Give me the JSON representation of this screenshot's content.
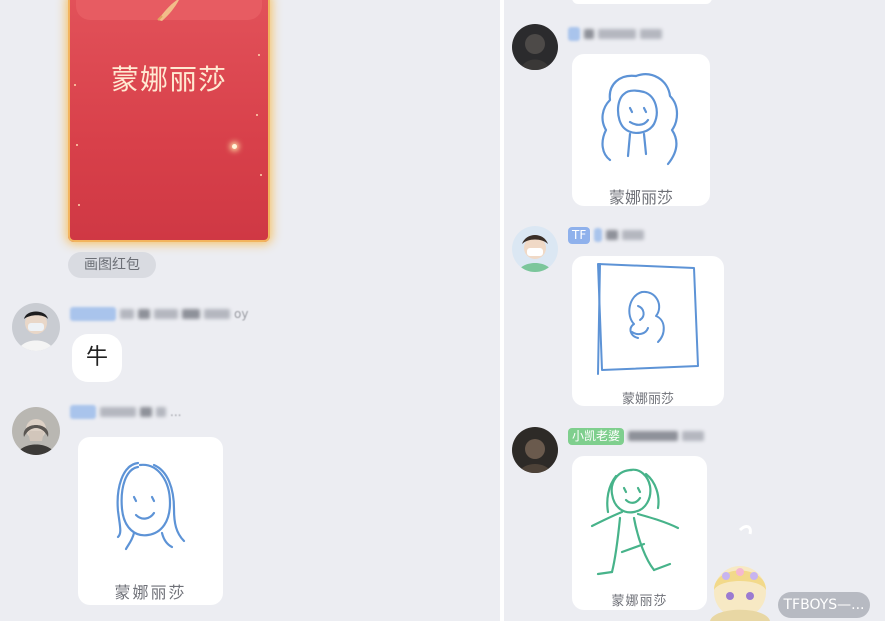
{
  "left_pane": {
    "red_envelope": {
      "title": "蒙娜丽莎"
    },
    "envelope_tag": "画图红包",
    "msg1": {
      "name_fragment": "oy",
      "text": "牛"
    },
    "msg2": {
      "name_fragment": "...",
      "caption": "蒙娜丽莎"
    }
  },
  "right_pane": {
    "msg1": {
      "caption": "蒙娜丽莎"
    },
    "msg2": {
      "badge": "TF",
      "caption": "蒙娜丽莎"
    },
    "msg3": {
      "badge": "小凯老婆",
      "caption": "蒙娜丽莎"
    }
  },
  "floating_label": "TFBOYS—...",
  "colors": {
    "background": "#ecedf2",
    "envelope_red": "#d8404a",
    "envelope_glow": "#f6bf5c",
    "drawing_blue": "#5d93d6",
    "drawing_green": "#47b38a",
    "badge_blue": "#8fb1ec",
    "badge_green": "#7fcf8e"
  }
}
